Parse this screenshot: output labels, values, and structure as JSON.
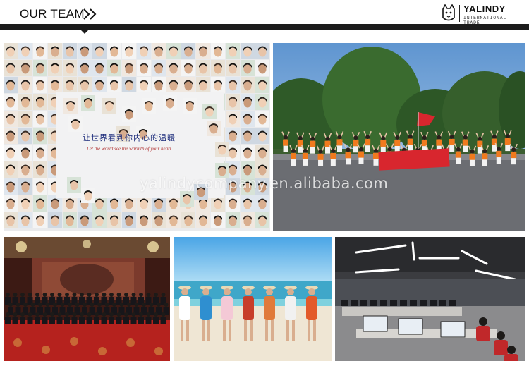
{
  "header": {
    "title": "OUR TEAM",
    "brand_name": "YALINDY",
    "brand_sub": "INTERNATIONAL TRADE"
  },
  "photos": {
    "mosaic": {
      "slogan_cn": "让世界看到你内心的温暖",
      "slogan_en": "Let the world see the warmth of your heart"
    },
    "outdoor_group": {
      "banner_color": "#d8262e",
      "shirt_color": "#f07a1e"
    },
    "ballroom_group": {
      "carpet_color": "#b5221e"
    },
    "beach_group": {
      "sea_color": "#3fa7c9"
    },
    "office": {
      "light_color": "#ffffff"
    }
  },
  "watermark": "yalindycompany.en.alibaba.com",
  "colors": {
    "rule": "#1c1c1c",
    "accent_orange": "#f07a1e",
    "accent_red": "#d8262e"
  }
}
